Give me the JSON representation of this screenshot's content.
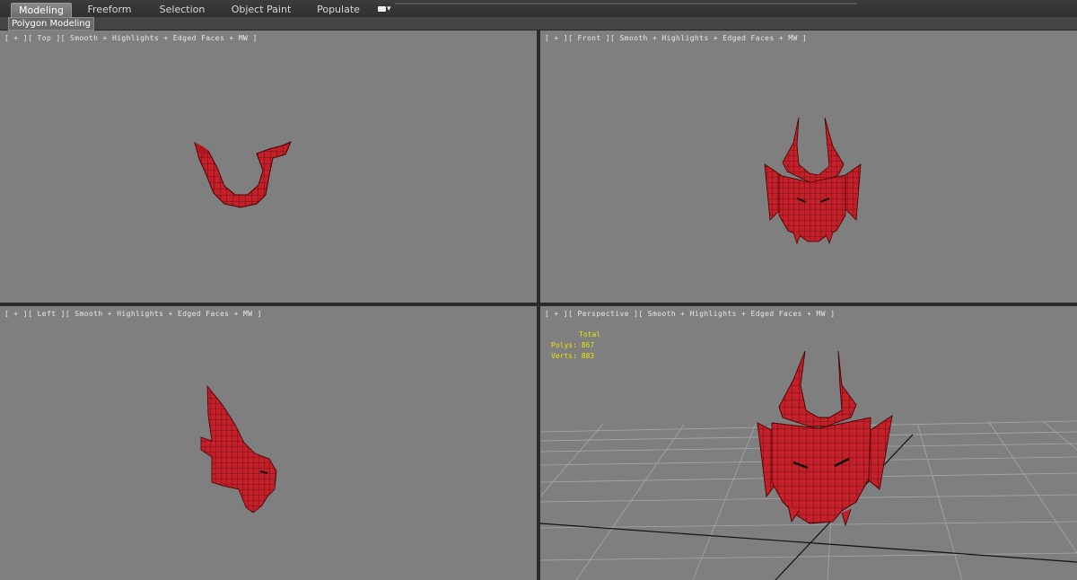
{
  "ribbon": {
    "tabs": [
      {
        "label": "Modeling",
        "active": true
      },
      {
        "label": "Freeform",
        "active": false
      },
      {
        "label": "Selection",
        "active": false
      },
      {
        "label": "Object Paint",
        "active": false
      },
      {
        "label": "Populate",
        "active": false
      }
    ],
    "menu_icon": "ribbon-options-icon",
    "panel_title": "Polygon Modeling"
  },
  "viewports": {
    "top": {
      "label": "[ + ][ Top ][ Smooth + Highlights + Edged Faces + MW ]"
    },
    "front": {
      "label": "[ + ][ Front ][ Smooth + Highlights + Edged Faces + MW ]"
    },
    "left": {
      "label": "[ + ][ Left ][ Smooth + Highlights + Edged Faces + MW ]"
    },
    "perspective": {
      "label": "[ + ][ Perspective ][ Smooth + Highlights + Edged Faces + MW ]",
      "stats": {
        "title": "Total",
        "polys": "Polys: 867",
        "verts": "Verts: 883"
      }
    }
  },
  "colors": {
    "viewport_bg": "#7f7f7f",
    "model_red": "#c4202a",
    "wire": "#2a0000",
    "stats_yellow": "#e6e600"
  }
}
